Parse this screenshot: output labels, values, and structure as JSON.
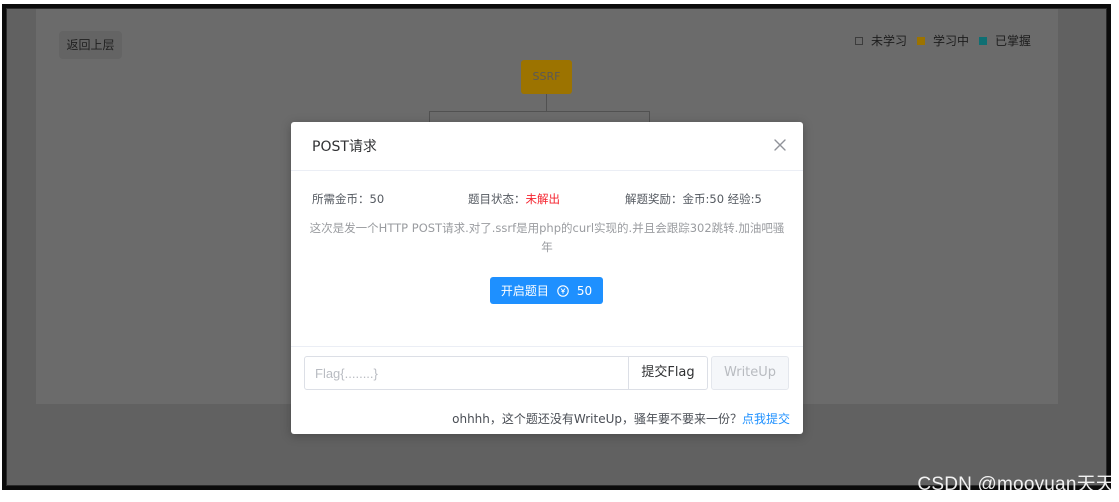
{
  "background": {
    "back_label": "返回上层",
    "legend": [
      {
        "label": "未学习",
        "color": "#6b6b6b",
        "outline": "#3c3c3c"
      },
      {
        "label": "学习中",
        "color": "#9c7300",
        "outline": "#9c7300"
      },
      {
        "label": "已掌握",
        "color": "#0f6f73",
        "outline": "#0f6f73"
      }
    ],
    "node_label": "SSRF",
    "node_color": "#9c7300"
  },
  "modal": {
    "title": "POST请求",
    "cost_label": "所需金币：",
    "cost_value": "50",
    "status_label": "题目状态：",
    "status_value": "未解出",
    "status_color": "#f5222d",
    "reward_label": "解题奖励：",
    "reward_value": "金币:50 经验:5",
    "description": "这次是发一个HTTP POST请求.对了.ssrf是用php的curl实现的.并且会跟踪302跳转.加油吧骚年",
    "start_label": "开启题目",
    "start_cost": "50",
    "accent_color": "#1e90ff",
    "flag_placeholder": "Flag{........}",
    "flag_value": "",
    "submit_label": "提交Flag",
    "writeup_label": "WriteUp",
    "footer_note": "ohhhh，这个题还没有WriteUp，骚年要不要来一份？",
    "footer_link": "点我提交"
  },
  "watermark": "CSDN @mooyuan天天"
}
